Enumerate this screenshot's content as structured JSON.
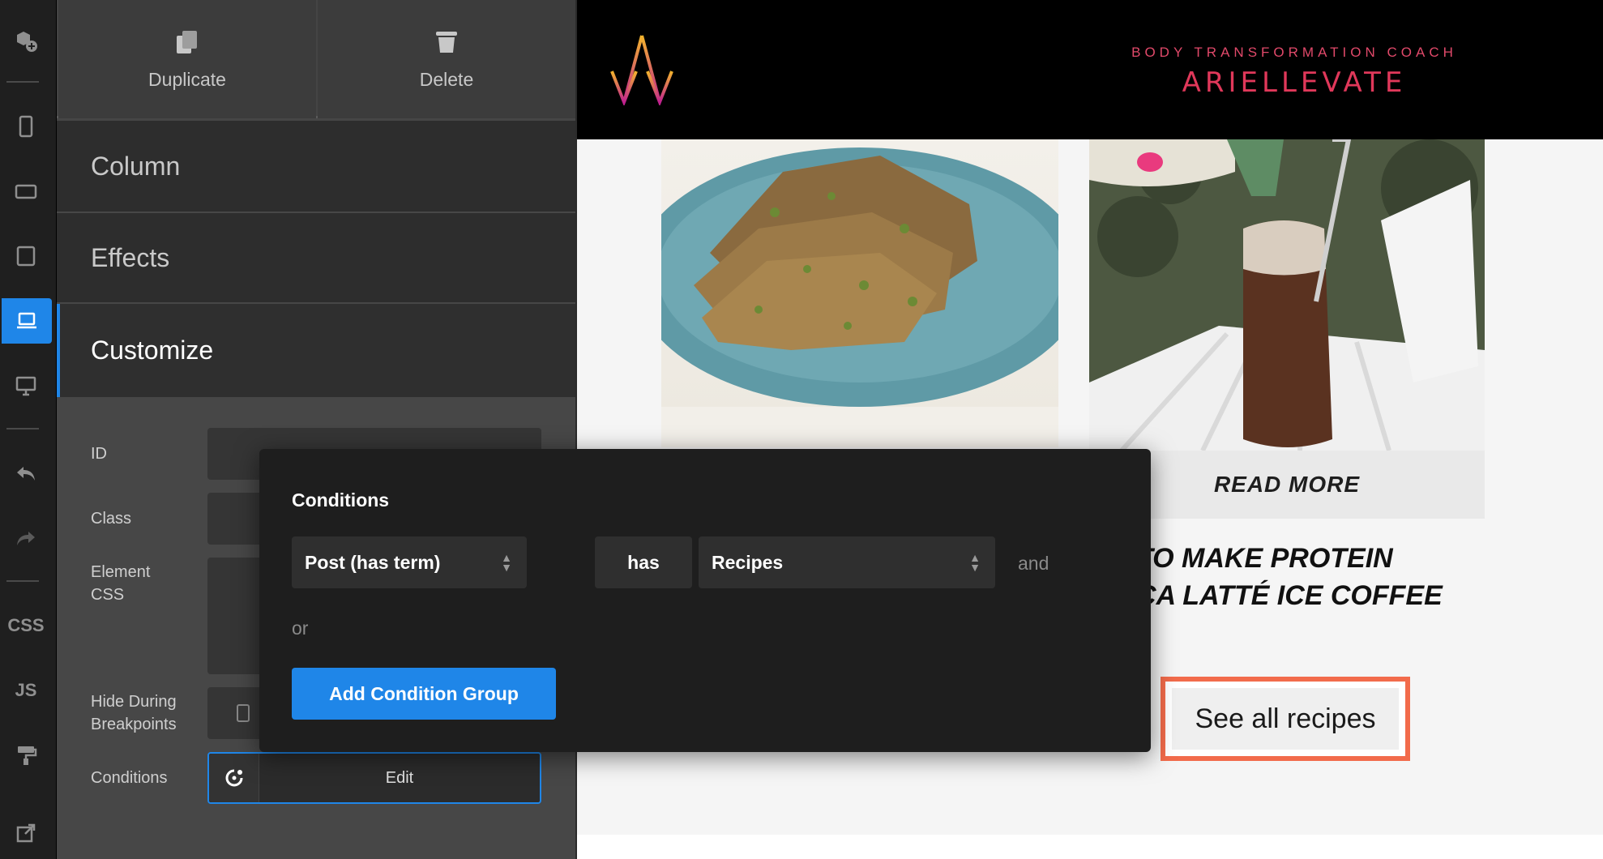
{
  "toolbar": {
    "duplicate_label": "Duplicate",
    "delete_label": "Delete"
  },
  "sidebar": {
    "sections": [
      {
        "label": "Column"
      },
      {
        "label": "Effects"
      },
      {
        "label": "Customize"
      }
    ],
    "active_section": "Customize"
  },
  "rail": {
    "items": [
      "add-element-icon",
      "mobile-portrait-icon",
      "mobile-landscape-icon",
      "tablet-icon",
      "laptop-icon",
      "desktop-icon",
      "undo-icon",
      "redo-icon"
    ],
    "css_label": "CSS",
    "js_label": "JS",
    "active": "laptop-icon",
    "accent": "#1f86e8"
  },
  "customize": {
    "id_label": "ID",
    "class_label": "Class",
    "element_css_label": "Element CSS",
    "hide_label": "Hide During Breakpoints",
    "conditions_label": "Conditions",
    "conditions_edit": "Edit"
  },
  "popup": {
    "title": "Conditions",
    "condition": {
      "field": "Post (has term)",
      "operator": "has",
      "value": "Recipes"
    },
    "and_label": "and",
    "or_label": "or",
    "add_group_label": "Add Condition Group",
    "accent": "#1f86e8"
  },
  "preview": {
    "tagline": "BODY TRANSFORMATION COACH",
    "brand": "ARIELLEVATE",
    "read_more": "READ MORE",
    "post_title_line1": "TO MAKE PROTEIN",
    "post_title_line2": "CA LATTÉ ICE COFFEE",
    "see_all": "See all recipes",
    "highlight_color": "#f26b4b"
  }
}
